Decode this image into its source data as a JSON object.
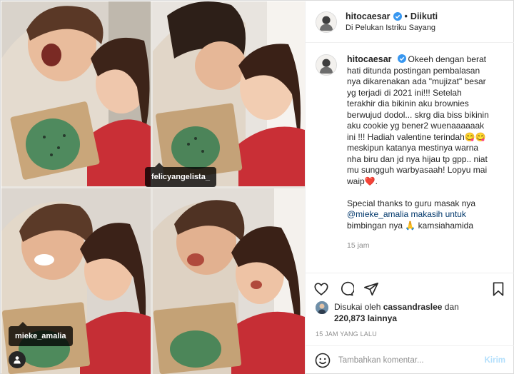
{
  "post": {
    "username": "hitocaesar",
    "follow_status": "Diikuti",
    "location": "Di Pelukan Istriku Sayang"
  },
  "photo_tags": {
    "tag1": "felicyangelista_",
    "tag2": "mieke_amalia"
  },
  "caption": {
    "username": "hitocaesar",
    "lines": [
      "Okeeh dengan berat",
      "hati ditunda postingan pembalasan",
      "nya dikarenakan ada \"mujizat\" besar",
      "yg terjadi di 2021 ini!!! Setelah",
      "terakhir dia bikinin aku brownies",
      "berwujud dodol... skrg dia biss bikinin",
      "aku cookie yg bener2 wuenaaaaaak",
      "ini !!! Hadiah valentine terindah😋😋",
      "meskipun katanya mestinya warna",
      "nha biru dan jd nya hijau tp gpp.. niat",
      "mu sungguh warbyasaah! Lopyu mai",
      "waip❤️.",
      "",
      "Special thanks to guru masak nya",
      "@mieke_amalia makasih untuk",
      "bimbingan nya 🙏 kamsiahamida"
    ],
    "time_ago": "15 jam"
  },
  "likes": {
    "prefix": "Disukai oleh",
    "user": "cassandraslee",
    "connector": "dan",
    "count": "220,873 lainnya"
  },
  "posted_time": "15 JAM YANG LALU",
  "comment": {
    "placeholder": "Tambahkan komentar...",
    "post_label": "Kirim"
  },
  "colors": {
    "verified": "#3897f0",
    "link": "#00376b",
    "heart": "#ed4956",
    "post_disabled": "#b2dffc"
  },
  "icons": [
    "verified-badge-icon",
    "heart-icon",
    "comment-icon",
    "share-icon",
    "bookmark-icon",
    "emoji-icon",
    "user-tag-icon"
  ]
}
